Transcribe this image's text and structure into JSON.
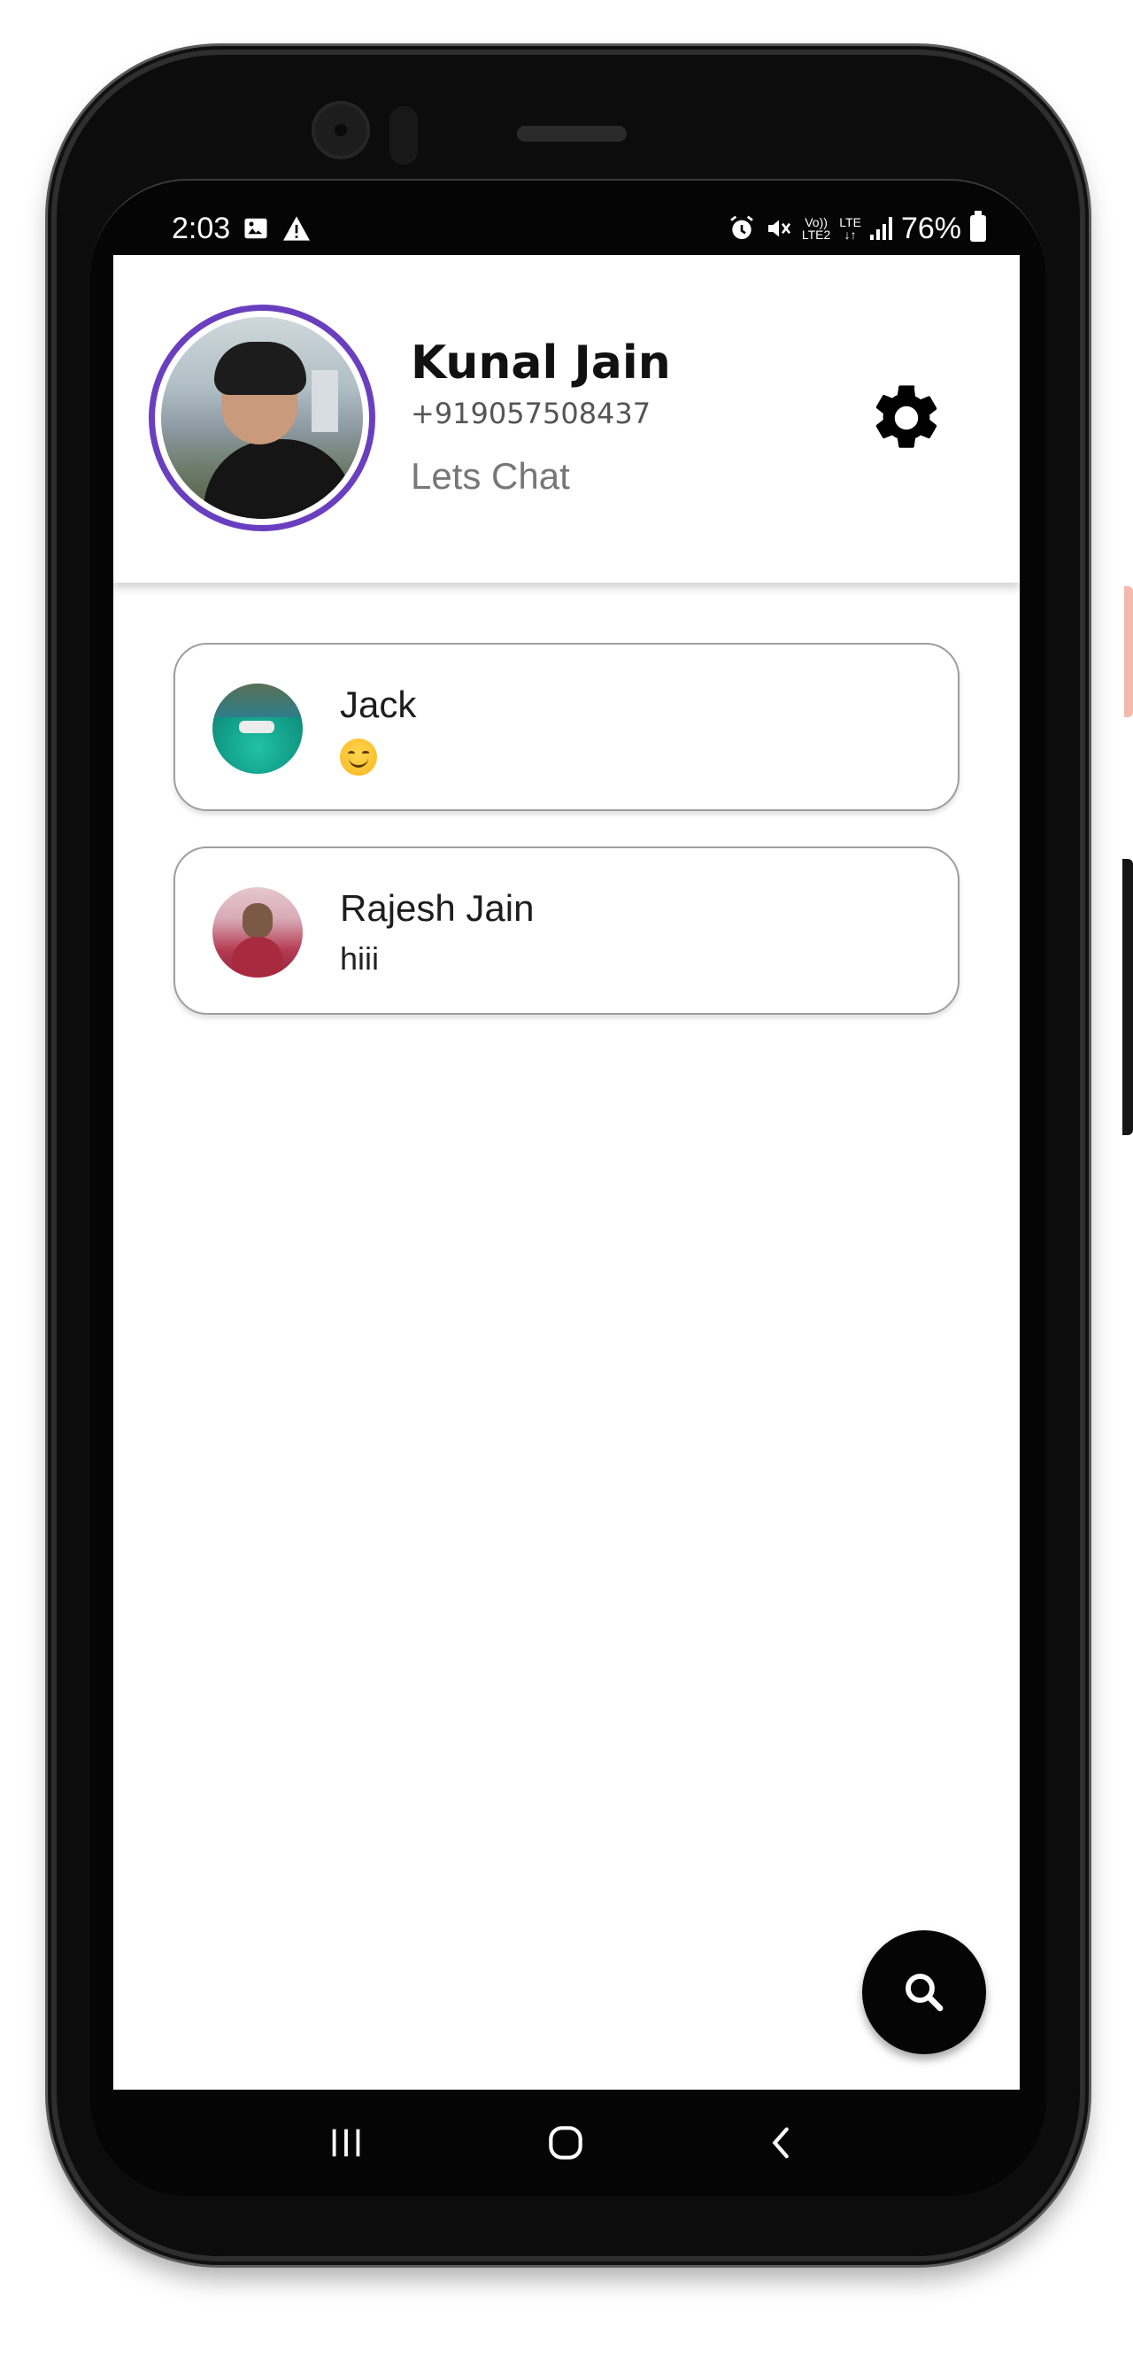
{
  "status_bar": {
    "time": "2:03",
    "volte_top": "Vo))",
    "volte_bottom": "LTE2",
    "lte_top": "LTE",
    "lte_bottom": "↓↑",
    "battery": "76%",
    "icons": [
      "gallery-icon",
      "warning-icon",
      "alarm-icon",
      "mute-icon",
      "signal-icon",
      "battery-icon"
    ]
  },
  "profile": {
    "name": "Kunal Jain",
    "phone": "+919057508437",
    "status": "Lets Chat"
  },
  "chats": [
    {
      "name": "Jack",
      "message_emoji": "smiling-face-emoji"
    },
    {
      "name": "Rajesh Jain",
      "message": "hiii"
    }
  ],
  "fab": {
    "icon": "search-icon"
  },
  "navigation": {
    "icons": [
      "recents-icon",
      "home-icon",
      "back-icon"
    ]
  },
  "colors": {
    "avatar_ring": "#6a3fbf",
    "card_border": "#9e9e9e",
    "fab_background": "#050505",
    "status_text": "#777777"
  }
}
